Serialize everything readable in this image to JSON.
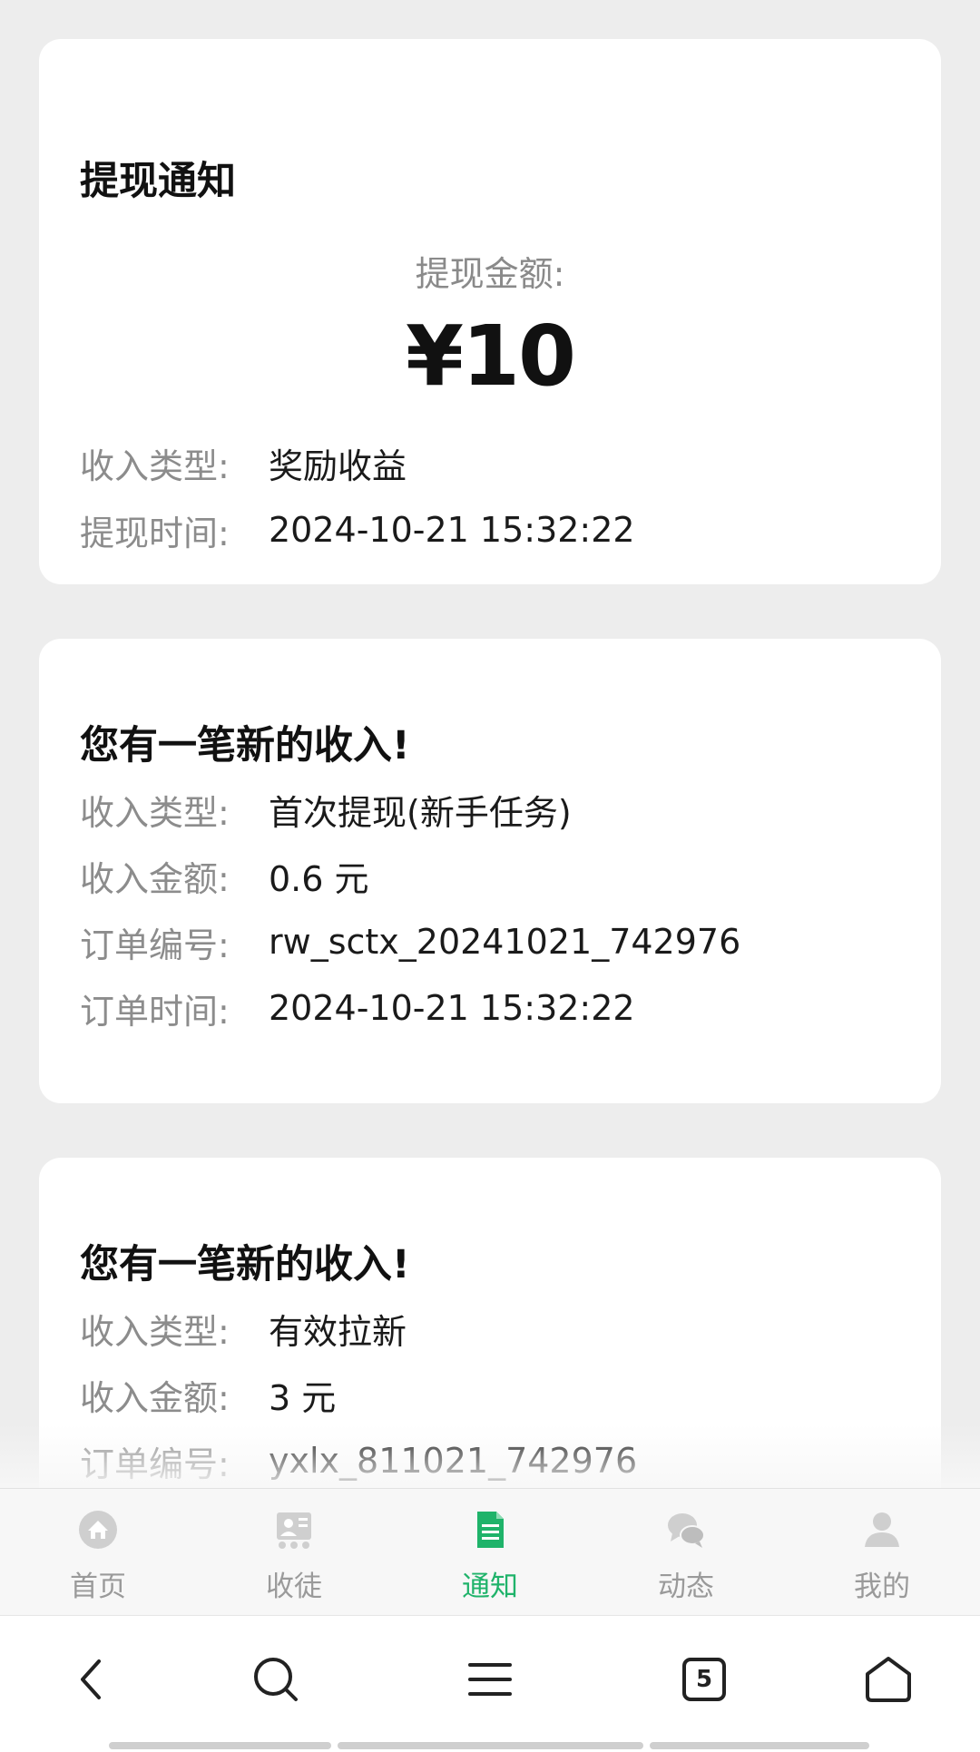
{
  "cards": [
    {
      "title": "提现通知",
      "amount_label": "提现金额:",
      "amount_value": "¥10",
      "rows": [
        {
          "key": "收入类型:",
          "value": "奖励收益"
        },
        {
          "key": "提现时间:",
          "value": "2024-10-21 15:32:22"
        }
      ]
    },
    {
      "title": "您有一笔新的收入!",
      "rows": [
        {
          "key": "收入类型:",
          "value": "首次提现(新手任务)"
        },
        {
          "key": "收入金额:",
          "value": "0.6 元"
        },
        {
          "key": "订单编号:",
          "value": "rw_sctx_20241021_742976"
        },
        {
          "key": "订单时间:",
          "value": "2024-10-21 15:32:22"
        }
      ]
    },
    {
      "title": "您有一笔新的收入!",
      "rows": [
        {
          "key": "收入类型:",
          "value": "有效拉新"
        },
        {
          "key": "收入金额:",
          "value": "3 元"
        },
        {
          "key": "订单编号:",
          "value": "yxlx_811021_742976"
        }
      ]
    }
  ],
  "tabbar": {
    "items": [
      {
        "label": "首页",
        "icon": "home-icon"
      },
      {
        "label": "收徒",
        "icon": "recruit-icon"
      },
      {
        "label": "通知",
        "icon": "notice-icon"
      },
      {
        "label": "动态",
        "icon": "chat-icon"
      },
      {
        "label": "我的",
        "icon": "user-icon"
      }
    ],
    "active": "通知",
    "active_color": "#1fb36a",
    "inactive_color": "#b5b5b5"
  },
  "browser_nav": {
    "tabs_count": "5",
    "icons": [
      "back-icon",
      "search-icon",
      "menu-icon",
      "tabs-icon",
      "home-icon"
    ]
  }
}
